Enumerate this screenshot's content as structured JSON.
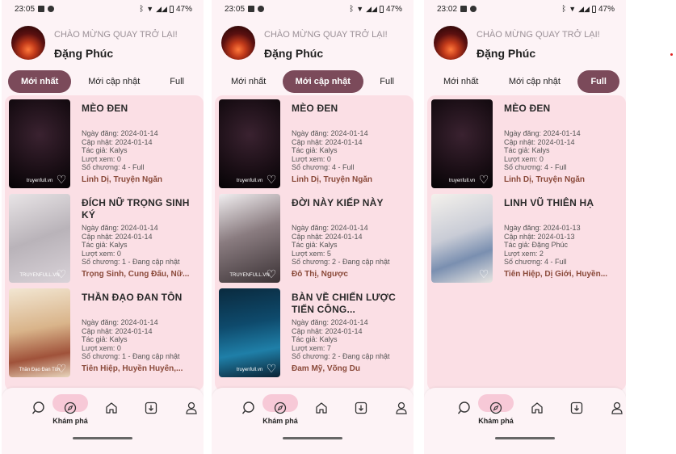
{
  "screens": [
    {
      "time": "23:05",
      "battery": "47%",
      "welcome": "CHÀO MỪNG QUAY TRỞ LẠI!",
      "user": "Đặng Phúc",
      "tabs": [
        "Mới nhất",
        "Mới cập nhật",
        "Full"
      ],
      "active_tab": 0,
      "items": [
        {
          "title": "MÈO ĐEN",
          "meta": [
            "Ngày đăng: 2024-01-14",
            "Cập nhật: 2024-01-14",
            "Tác giả: Kalys",
            "Lượt xem: 0",
            "Số chương: 4 - Full"
          ],
          "genres": "Linh Dị, Truyện Ngắn",
          "cover": "dark",
          "wm": "truyenfull.vn"
        },
        {
          "title": "ĐÍCH NỮ TRỌNG SINH KÝ",
          "meta": [
            "Ngày đăng: 2024-01-14",
            "Cập nhật: 2024-01-14",
            "Tác giả: Kalys",
            "Lượt xem: 0",
            "Số chương: 1 - Đang cập nhật"
          ],
          "genres": "Trọng Sinh, Cung Đấu, Nữ...",
          "cover": "white",
          "wm": "TRUYENFULL.VN"
        },
        {
          "title": "THẦN ĐẠO ĐAN TÔN",
          "meta": [
            "Ngày đăng: 2024-01-14",
            "Cập nhật: 2024-01-14",
            "Tác giả: Kalys",
            "Lượt xem: 0",
            "Số chương: 1 - Đang cập nhật"
          ],
          "genres": "Tiên Hiệp, Huyền Huyễn,...",
          "cover": "warm",
          "wm": "Thần Đạo Đan Tôn"
        }
      ]
    },
    {
      "time": "23:05",
      "battery": "47%",
      "welcome": "CHÀO MỪNG QUAY TRỞ LẠI!",
      "user": "Đặng Phúc",
      "tabs": [
        "Mới nhất",
        "Mới cập nhật",
        "Full"
      ],
      "active_tab": 1,
      "items": [
        {
          "title": "MÈO ĐEN",
          "meta": [
            "Ngày đăng: 2024-01-14",
            "Cập nhật: 2024-01-14",
            "Tác giả: Kalys",
            "Lượt xem: 0",
            "Số chương: 4 - Full"
          ],
          "genres": "Linh Dị, Truyện Ngắn",
          "cover": "dark",
          "wm": "truyenfull.vn"
        },
        {
          "title": "ĐỜI NÀY KIẾP NÀY",
          "meta": [
            "Ngày đăng: 2024-01-14",
            "Cập nhật: 2024-01-14",
            "Tác giả: Kalys",
            "Lượt xem: 5",
            "Số chương: 2 - Đang cập nhật"
          ],
          "genres": "Đô Thị, Ngược",
          "cover": "grey",
          "wm": "TRUYENFULL.VN"
        },
        {
          "title": "BÀN VỀ CHIẾN LƯỢC TIẾN CÔNG...",
          "meta": [
            "Ngày đăng: 2024-01-14",
            "Cập nhật: 2024-01-14",
            "Tác giả: Kalys",
            "Lượt xem: 7",
            "Số chương: 2 - Đang cập nhật"
          ],
          "genres": "Đam Mỹ, Võng Du",
          "cover": "blue",
          "wm": "truyenfull.vn"
        }
      ]
    },
    {
      "time": "23:02",
      "battery": "47%",
      "welcome": "CHÀO MỪNG QUAY TRỞ LẠI!",
      "user": "Đặng Phúc",
      "tabs": [
        "Mới nhất",
        "Mới cập nhật",
        "Full"
      ],
      "active_tab": 2,
      "items": [
        {
          "title": "MÈO ĐEN",
          "meta": [
            "Ngày đăng: 2024-01-14",
            "Cập nhật: 2024-01-14",
            "Tác giả: Kalys",
            "Lượt xem: 0",
            "Số chương: 4 - Full"
          ],
          "genres": "Linh Dị, Truyện Ngắn",
          "cover": "dark",
          "wm": "truyenfull.vn"
        },
        {
          "title": "LINH VŨ THIÊN HẠ",
          "meta": [
            "Ngày đăng: 2024-01-13",
            "Cập nhật: 2024-01-13",
            "Tác giả: Đặng Phúc",
            "Lượt xem: 2",
            "Số chương: 4 - Full"
          ],
          "genres": "Tiên Hiệp, Dị Giới, Huyền...",
          "cover": "paper",
          "wm": ""
        }
      ]
    }
  ],
  "nav": {
    "active_label": "Khám phá",
    "icons": [
      "search-icon",
      "explore-icon",
      "home-icon",
      "download-icon",
      "profile-icon"
    ]
  },
  "colors": {
    "accent": "#7b4a5a",
    "list_bg": "#fbdfe5",
    "page_bg": "#fdf3f6",
    "genre": "#8a4a3a"
  }
}
